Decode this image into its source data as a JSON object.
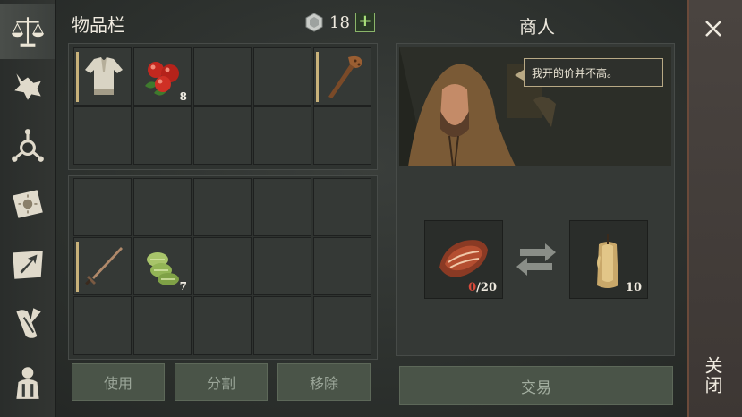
{
  "inventory": {
    "title": "物品栏",
    "currency": {
      "icon": "stone-coin-icon",
      "amount": "18",
      "add_label": "+"
    },
    "slots": [
      {
        "item": "linen-shirt",
        "count": ""
      },
      {
        "item": "red-berries",
        "count": "8"
      },
      {
        "item": "",
        "count": ""
      },
      {
        "item": "",
        "count": ""
      },
      {
        "item": "wooden-club",
        "count": ""
      },
      {
        "item": "bronze-sword",
        "count": ""
      },
      {
        "item": "green-herb-sprouts",
        "count": "7"
      }
    ],
    "buttons": {
      "use": "使用",
      "split": "分割",
      "remove": "移除"
    }
  },
  "merchant": {
    "title": "商人",
    "speech": "我开的价并不高。",
    "give": {
      "item": "raw-meat",
      "have": "0",
      "need": "/20"
    },
    "receive": {
      "item": "candle",
      "count": "10"
    },
    "trade_label": "交易"
  },
  "close": {
    "label": "关闭"
  },
  "colors": {
    "accent_green": "#a8e07a",
    "need_red": "#d94a3a",
    "quality_bar": "#c9b27a"
  }
}
